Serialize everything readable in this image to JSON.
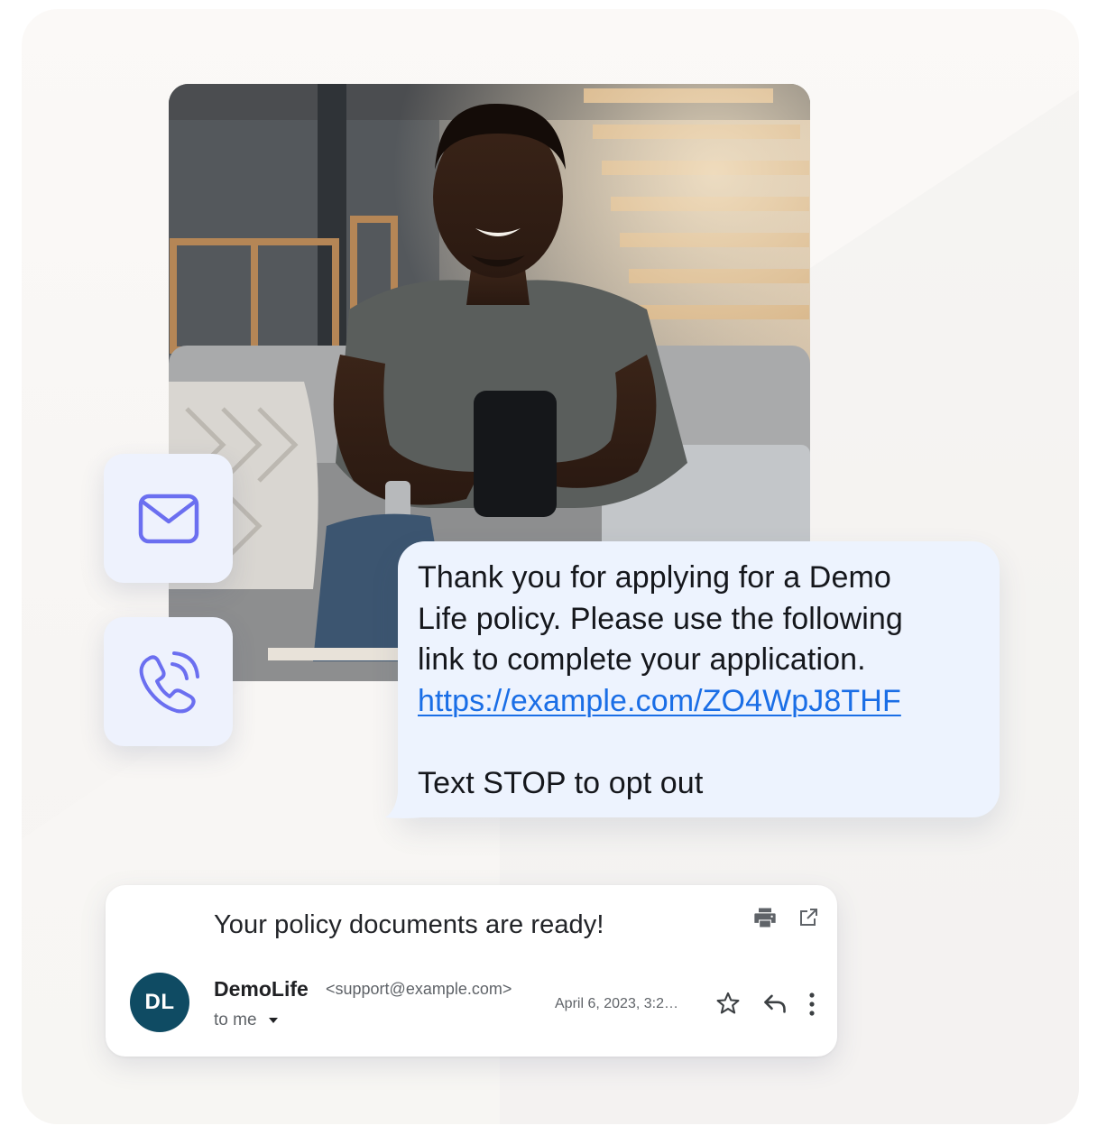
{
  "sms": {
    "line1": "Thank you for applying for a Demo",
    "line2": "Life policy. Please use the following",
    "line3": "link to complete your application.",
    "link": "https://example.com/ZO4WpJ8THF",
    "opt_out": "Text STOP to opt out"
  },
  "channels": {
    "email_icon": "envelope-icon",
    "phone_icon": "phone-call-icon",
    "accent_color": "#6b6ff0"
  },
  "email": {
    "subject": "Your policy documents are ready!",
    "avatar_initials": "DL",
    "avatar_color": "#0f4b63",
    "sender_name": "DemoLife",
    "sender_address": "<support@example.com>",
    "recipient": "to me",
    "date": "April 6, 2023, 3:2…",
    "icons": [
      "printer-icon",
      "open-in-new-icon",
      "star-icon",
      "reply-icon",
      "more-vertical-icon",
      "caret-down-icon"
    ]
  },
  "photo": {
    "subject_icon": "photo-man-with-phone"
  }
}
